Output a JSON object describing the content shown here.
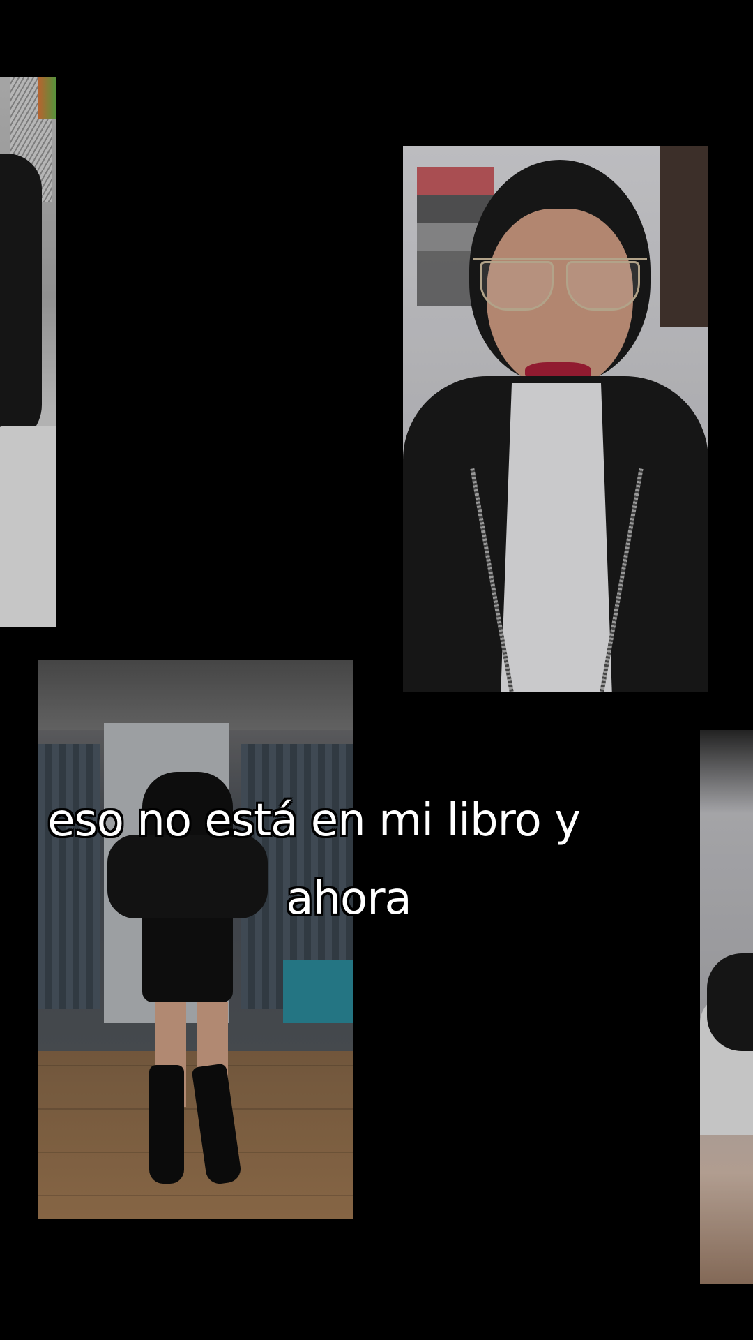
{
  "caption": {
    "line1": "eso no está en mi libro y",
    "line2": "ahora"
  }
}
